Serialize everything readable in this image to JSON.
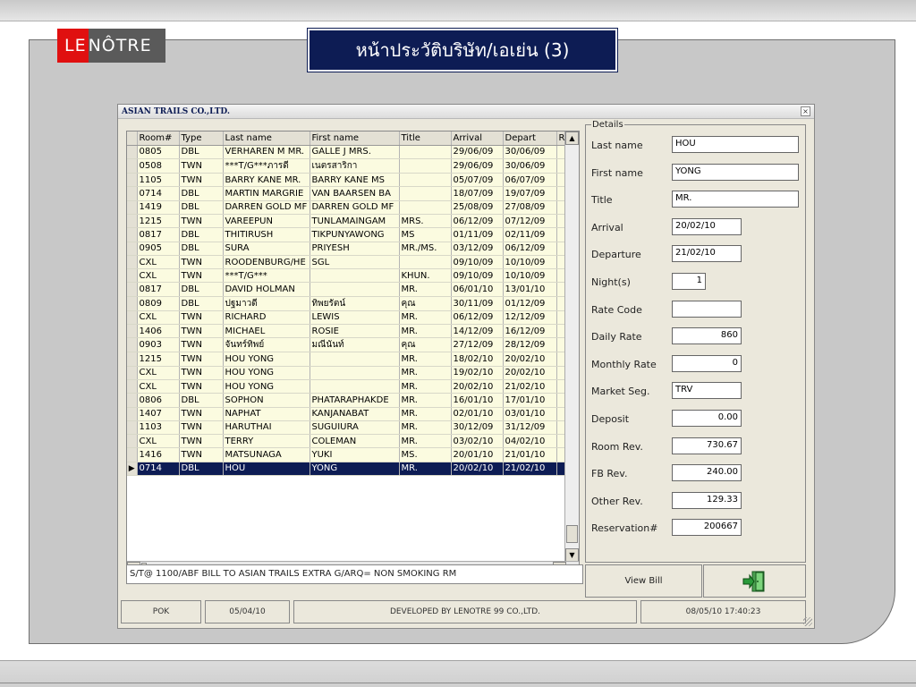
{
  "slide": {
    "logo_le": "LE",
    "logo_notre": "NÔTRE",
    "title": "หน้าประวัติบริษัท/เอเย่น (3)"
  },
  "window": {
    "title": "ASIAN TRAILS CO.,LTD.",
    "close_glyph": "×"
  },
  "grid": {
    "columns": [
      "Room#",
      "Type",
      "Last name",
      "First name",
      "Title",
      "Arrival",
      "Depart",
      "R"
    ],
    "rows": [
      [
        "0805",
        "DBL",
        "VERHAREN M MR.",
        "GALLE J MRS.",
        "",
        "29/06/09",
        "30/06/09"
      ],
      [
        "0508",
        "TWN",
        "***T/G***ภารดี",
        "เนตรสาริกา",
        "",
        "29/06/09",
        "30/06/09"
      ],
      [
        "1105",
        "TWN",
        "BARRY KANE MR.",
        "BARRY KANE MS",
        "",
        "05/07/09",
        "06/07/09"
      ],
      [
        "0714",
        "DBL",
        "MARTIN MARGRIE",
        "VAN BAARSEN BA",
        "",
        "18/07/09",
        "19/07/09"
      ],
      [
        "1419",
        "DBL",
        "DARREN GOLD MF",
        "DARREN GOLD MF",
        "",
        "25/08/09",
        "27/08/09"
      ],
      [
        "1215",
        "TWN",
        "VAREEPUN",
        "TUNLAMAINGAM",
        "MRS.",
        "06/12/09",
        "07/12/09"
      ],
      [
        "0817",
        "DBL",
        "THITIRUSH",
        "TIKPUNYAWONG",
        "MS",
        "01/11/09",
        "02/11/09"
      ],
      [
        "0905",
        "DBL",
        "SURA",
        "PRIYESH",
        "MR./MS.",
        "03/12/09",
        "06/12/09"
      ],
      [
        "CXL",
        "TWN",
        "ROODENBURG/HE",
        "SGL",
        "",
        "09/10/09",
        "10/10/09"
      ],
      [
        "CXL",
        "TWN",
        "***T/G***",
        "",
        "KHUN.",
        "09/10/09",
        "10/10/09"
      ],
      [
        "0817",
        "DBL",
        "DAVID HOLMAN",
        "",
        "MR.",
        "06/01/10",
        "13/01/10"
      ],
      [
        "0809",
        "DBL",
        "ปฐมาวดี",
        "ทิพยรัตน์",
        "คุณ",
        "30/11/09",
        "01/12/09"
      ],
      [
        "CXL",
        "TWN",
        "RICHARD",
        "LEWIS",
        "MR.",
        "06/12/09",
        "12/12/09"
      ],
      [
        "1406",
        "TWN",
        "MICHAEL",
        "ROSIE",
        "MR.",
        "14/12/09",
        "16/12/09"
      ],
      [
        "0903",
        "TWN",
        "จันทร์ทิพย์",
        "มณีนันท์",
        "คุณ",
        "27/12/09",
        "28/12/09"
      ],
      [
        "1215",
        "TWN",
        "HOU YONG",
        "",
        "MR.",
        "18/02/10",
        "20/02/10"
      ],
      [
        "CXL",
        "TWN",
        "HOU YONG",
        "",
        "MR.",
        "19/02/10",
        "20/02/10"
      ],
      [
        "CXL",
        "TWN",
        "HOU YONG",
        "",
        "MR.",
        "20/02/10",
        "21/02/10"
      ],
      [
        "0806",
        "DBL",
        "SOPHON",
        "PHATARAPHAKDE",
        "MR.",
        "16/01/10",
        "17/01/10"
      ],
      [
        "1407",
        "TWN",
        "NAPHAT",
        "KANJANABAT",
        "MR.",
        "02/01/10",
        "03/01/10"
      ],
      [
        "1103",
        "TWN",
        "HARUTHAI",
        "SUGUIURA",
        "MR.",
        "30/12/09",
        "31/12/09"
      ],
      [
        "CXL",
        "TWN",
        "TERRY",
        "COLEMAN",
        "MR.",
        "03/02/10",
        "04/02/10"
      ],
      [
        "1416",
        "TWN",
        "MATSUNAGA",
        "YUKI",
        "MS.",
        "20/01/10",
        "21/01/10"
      ],
      [
        "0714",
        "DBL",
        "HOU",
        "YONG",
        "MR.",
        "20/02/10",
        "21/02/10"
      ]
    ],
    "selected_row": 23
  },
  "details": {
    "legend": "Details",
    "fields": [
      {
        "label": "Last name",
        "value": "HOU"
      },
      {
        "label": "First name",
        "value": "YONG"
      },
      {
        "label": "Title",
        "value": "MR."
      },
      {
        "label": "Arrival",
        "value": "20/02/10"
      },
      {
        "label": "Departure",
        "value": "21/02/10"
      },
      {
        "label": "Night(s)",
        "value": "1"
      },
      {
        "label": "Rate Code",
        "value": ""
      },
      {
        "label": "Daily Rate",
        "value": "860"
      },
      {
        "label": "Monthly Rate",
        "value": "0"
      },
      {
        "label": "Market Seg.",
        "value": "TRV"
      },
      {
        "label": "Deposit",
        "value": "0.00"
      },
      {
        "label": "Room Rev.",
        "value": "730.67"
      },
      {
        "label": "FB   Rev.",
        "value": "240.00"
      },
      {
        "label": "Other Rev.",
        "value": "129.33"
      },
      {
        "label": "Reservation#",
        "value": "200667"
      }
    ]
  },
  "remark": "S/T@ 1100/ABF BILL TO ASIAN TRAILS  EXTRA G/ARQ= NON SMOKING RM",
  "buttons": {
    "view_bill": "View Bill",
    "exit_icon": "exit-door-icon"
  },
  "statusbar": {
    "user": "POK",
    "date": "05/04/10",
    "developer": "DEVELOPED BY LENOTRE 99 CO.,LTD.",
    "datetime": "08/05/10  17:40:23"
  },
  "colors": {
    "title_bg": "#0d1c54",
    "grid_row_bg": "#fbfbe0",
    "selected_row_bg": "#0d1c54",
    "logo_red": "#e01010"
  }
}
